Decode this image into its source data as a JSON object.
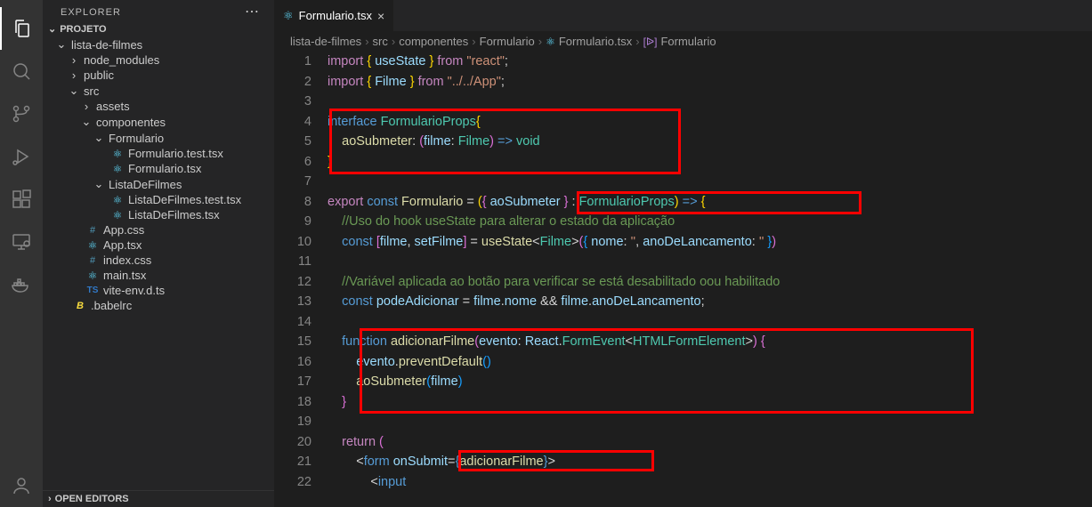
{
  "sidebar": {
    "title": "EXPLORER",
    "projectHeader": "PROJETO",
    "openEditors": "OPEN EDITORS",
    "tree": {
      "root": "lista-de-filmes",
      "node_modules": "node_modules",
      "public": "public",
      "src": "src",
      "assets": "assets",
      "componentes": "componentes",
      "formulario": "Formulario",
      "formulario_test": "Formulario.test.tsx",
      "formulario_tsx": "Formulario.tsx",
      "listadefilmes": "ListaDeFilmes",
      "listadefilmes_test": "ListaDeFilmes.test.tsx",
      "listadefilmes_tsx": "ListaDeFilmes.tsx",
      "app_css": "App.css",
      "app_tsx": "App.tsx",
      "index_css": "index.css",
      "main_tsx": "main.tsx",
      "vite_env": "vite-env.d.ts",
      "babelrc": ".babelrc"
    }
  },
  "tab": {
    "name": "Formulario.tsx"
  },
  "breadcrumbs": {
    "b1": "lista-de-filmes",
    "b2": "src",
    "b3": "componentes",
    "b4": "Formulario",
    "b5": "Formulario.tsx",
    "b6": "Formulario"
  },
  "gutter": [
    "1",
    "2",
    "3",
    "4",
    "5",
    "6",
    "7",
    "8",
    "9",
    "10",
    "11",
    "12",
    "13",
    "14",
    "15",
    "16",
    "17",
    "18",
    "19",
    "20",
    "21",
    "22"
  ],
  "code": {
    "l1_useState": "useState",
    "l1_from": "\"react\"",
    "l2_Filme": "Filme",
    "l2_from": "\"../../App\"",
    "l4_name": "FormularioProps",
    "l5_prop": "aoSubmeter",
    "l5_param": "filme",
    "l5_ptype": "Filme",
    "l5_ret": "void",
    "l8_name": "Formulario",
    "l8_destr": "aoSubmeter",
    "l8_type": "FormularioProps",
    "l9_cmt": "//Uso do hook useState para alterar o estado da aplicação",
    "l10_filme": "filme",
    "l10_setFilme": "setFilme",
    "l10_useState": "useState",
    "l10_type": "Filme",
    "l10_nome": "nome",
    "l10_ano": "anoDeLancamento",
    "l12_cmt": "//Variável aplicada ao botão para verificar se está desabilitado oou habilitado",
    "l13_podeAdicionar": "podeAdicionar",
    "l13_filme1": "filme",
    "l13_nome": "nome",
    "l13_filme2": "filme",
    "l13_ano": "anoDeLancamento",
    "l15_fn": "adicionarFilme",
    "l15_evento": "evento",
    "l15_react": "React",
    "l15_formEvent": "FormEvent",
    "l15_htmlForm": "HTMLFormElement",
    "l16_evento": "evento",
    "l16_prevent": "preventDefault",
    "l17_ao": "aoSubmeter",
    "l17_filme": "filme",
    "l21_form": "form",
    "l21_onSubmit": "onSubmit",
    "l21_handler": "adicionarFilme",
    "l22_input": "input"
  }
}
